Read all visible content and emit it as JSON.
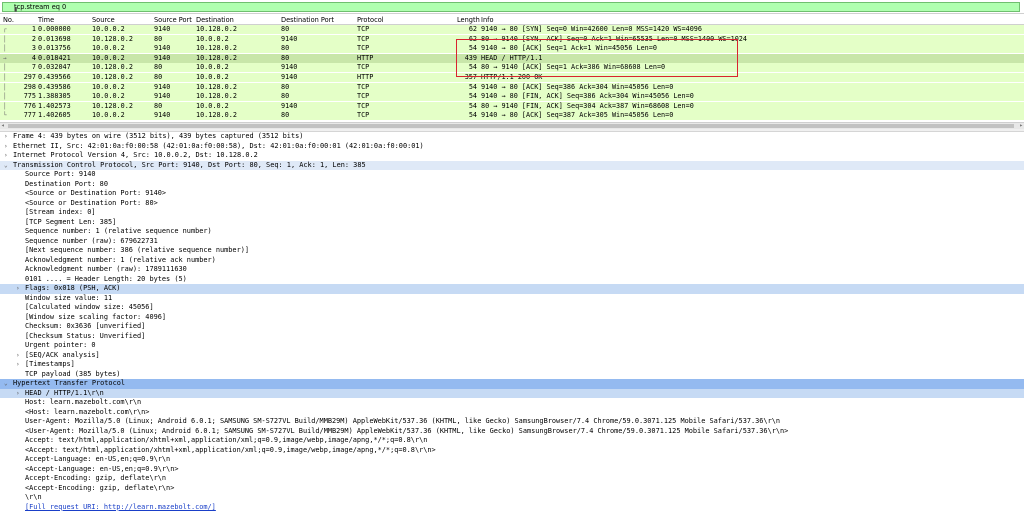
{
  "filter": {
    "value": "tcp.stream eq 0"
  },
  "columns": {
    "no": "No.",
    "time": "Time",
    "source": "Source",
    "sport": "Source Port",
    "dest": "Destination",
    "dport": "Destination Port",
    "proto": "Protocol",
    "length": "Length",
    "info": "Info"
  },
  "packets": [
    {
      "no": "1",
      "time": "0.000000",
      "src": "10.0.0.2",
      "sport": "9140",
      "dst": "10.128.0.2",
      "dport": "80",
      "proto": "TCP",
      "len": "62",
      "info": "9140 → 80 [SYN] Seq=0 Win=42600 Len=0 MSS=1420 WS=4096"
    },
    {
      "no": "2",
      "time": "0.013698",
      "src": "10.128.0.2",
      "sport": "80",
      "dst": "10.0.0.2",
      "dport": "9140",
      "proto": "TCP",
      "len": "62",
      "info": "80 → 9140 [SYN, ACK] Seq=0 Ack=1 Win=65535 Len=0 MSS=1400 WS=1024"
    },
    {
      "no": "3",
      "time": "0.013756",
      "src": "10.0.0.2",
      "sport": "9140",
      "dst": "10.128.0.2",
      "dport": "80",
      "proto": "TCP",
      "len": "54",
      "info": "9140 → 80 [ACK] Seq=1 Ack=1 Win=45056 Len=0"
    },
    {
      "no": "4",
      "time": "0.018421",
      "src": "10.0.0.2",
      "sport": "9140",
      "dst": "10.128.0.2",
      "dport": "80",
      "proto": "HTTP",
      "len": "439",
      "info": "HEAD / HTTP/1.1"
    },
    {
      "no": "7",
      "time": "0.032047",
      "src": "10.128.0.2",
      "sport": "80",
      "dst": "10.0.0.2",
      "dport": "9140",
      "proto": "TCP",
      "len": "54",
      "info": "80 → 9140 [ACK] Seq=1 Ack=386 Win=68608 Len=0"
    },
    {
      "no": "297",
      "time": "0.439566",
      "src": "10.128.0.2",
      "sport": "80",
      "dst": "10.0.0.2",
      "dport": "9140",
      "proto": "HTTP",
      "len": "357",
      "info": "HTTP/1.1 200 OK"
    },
    {
      "no": "298",
      "time": "0.439586",
      "src": "10.0.0.2",
      "sport": "9140",
      "dst": "10.128.0.2",
      "dport": "80",
      "proto": "TCP",
      "len": "54",
      "info": "9140 → 80 [ACK] Seq=386 Ack=304 Win=45056 Len=0"
    },
    {
      "no": "775",
      "time": "1.388305",
      "src": "10.0.0.2",
      "sport": "9140",
      "dst": "10.128.0.2",
      "dport": "80",
      "proto": "TCP",
      "len": "54",
      "info": "9140 → 80 [FIN, ACK] Seq=386 Ack=304 Win=45056 Len=0"
    },
    {
      "no": "776",
      "time": "1.402573",
      "src": "10.128.0.2",
      "sport": "80",
      "dst": "10.0.0.2",
      "dport": "9140",
      "proto": "TCP",
      "len": "54",
      "info": "80 → 9140 [FIN, ACK] Seq=304 Ack=387 Win=68608 Len=0"
    },
    {
      "no": "777",
      "time": "1.402605",
      "src": "10.0.0.2",
      "sport": "9140",
      "dst": "10.128.0.2",
      "dport": "80",
      "proto": "TCP",
      "len": "54",
      "info": "9140 → 80 [ACK] Seq=387 Ack=305 Win=45056 Len=0"
    }
  ],
  "selected_packet": "4",
  "details": [
    {
      "indent": 0,
      "arrow": "right",
      "text": "Frame 4: 439 bytes on wire (3512 bits), 439 bytes captured (3512 bits)"
    },
    {
      "indent": 0,
      "arrow": "right",
      "text": "Ethernet II, Src: 42:01:0a:f0:00:58 (42:01:0a:f0:00:58), Dst: 42:01:0a:f0:00:01 (42:01:0a:f0:00:01)"
    },
    {
      "indent": 0,
      "arrow": "right",
      "text": "Internet Protocol Version 4, Src: 10.0.0.2, Dst: 10.128.0.2"
    },
    {
      "indent": 0,
      "arrow": "down",
      "text": "Transmission Control Protocol, Src Port: 9140, Dst Port: 80, Seq: 1, Ack: 1, Len: 385",
      "hl": "hl1"
    },
    {
      "indent": 1,
      "text": "Source Port: 9140"
    },
    {
      "indent": 1,
      "text": "Destination Port: 80"
    },
    {
      "indent": 1,
      "text": "<Source or Destination Port: 9140>"
    },
    {
      "indent": 1,
      "text": "<Source or Destination Port: 80>"
    },
    {
      "indent": 1,
      "text": "[Stream index: 0]"
    },
    {
      "indent": 1,
      "text": "[TCP Segment Len: 385]"
    },
    {
      "indent": 1,
      "text": "Sequence number: 1    (relative sequence number)"
    },
    {
      "indent": 1,
      "text": "Sequence number (raw): 679622731"
    },
    {
      "indent": 1,
      "text": "[Next sequence number: 386    (relative sequence number)]"
    },
    {
      "indent": 1,
      "text": "Acknowledgment number: 1    (relative ack number)"
    },
    {
      "indent": 1,
      "text": "Acknowledgment number (raw): 1789111630"
    },
    {
      "indent": 1,
      "text": "0101 .... = Header Length: 20 bytes (5)"
    },
    {
      "indent": 1,
      "arrow": "right",
      "text": "Flags: 0x018 (PSH, ACK)",
      "hl": "hl2"
    },
    {
      "indent": 1,
      "text": "Window size value: 11"
    },
    {
      "indent": 1,
      "text": "[Calculated window size: 45056]"
    },
    {
      "indent": 1,
      "text": "[Window size scaling factor: 4096]"
    },
    {
      "indent": 1,
      "text": "Checksum: 0x3636 [unverified]"
    },
    {
      "indent": 1,
      "text": "[Checksum Status: Unverified]"
    },
    {
      "indent": 1,
      "text": "Urgent pointer: 0"
    },
    {
      "indent": 1,
      "arrow": "right",
      "text": "[SEQ/ACK analysis]"
    },
    {
      "indent": 1,
      "arrow": "right",
      "text": "[Timestamps]"
    },
    {
      "indent": 1,
      "text": "TCP payload (385 bytes)"
    },
    {
      "indent": 0,
      "arrow": "down",
      "text": "Hypertext Transfer Protocol",
      "hl": "hl3"
    },
    {
      "indent": 1,
      "arrow": "right",
      "text": "HEAD / HTTP/1.1\\r\\n",
      "hl": "hl2"
    },
    {
      "indent": 1,
      "text": "Host: learn.mazebolt.com\\r\\n"
    },
    {
      "indent": 1,
      "text": "<Host: learn.mazebolt.com\\r\\n>"
    },
    {
      "indent": 1,
      "text": "User-Agent: Mozilla/5.0 (Linux; Android 6.0.1; SAMSUNG SM-S727VL Build/MMB29M) AppleWebKit/537.36 (KHTML, like Gecko) SamsungBrowser/7.4 Chrome/59.0.3071.125 Mobile Safari/537.36\\r\\n"
    },
    {
      "indent": 1,
      "text": "<User-Agent: Mozilla/5.0 (Linux; Android 6.0.1; SAMSUNG SM-S727VL Build/MMB29M) AppleWebKit/537.36 (KHTML, like Gecko) SamsungBrowser/7.4 Chrome/59.0.3071.125 Mobile Safari/537.36\\r\\n>"
    },
    {
      "indent": 1,
      "text": "Accept: text/html,application/xhtml+xml,application/xml;q=0.9,image/webp,image/apng,*/*;q=0.8\\r\\n"
    },
    {
      "indent": 1,
      "text": "<Accept: text/html,application/xhtml+xml,application/xml;q=0.9,image/webp,image/apng,*/*;q=0.8\\r\\n>"
    },
    {
      "indent": 1,
      "text": "Accept-Language: en-US,en;q=0.9\\r\\n"
    },
    {
      "indent": 1,
      "text": "<Accept-Language: en-US,en;q=0.9\\r\\n>"
    },
    {
      "indent": 1,
      "text": "Accept-Encoding: gzip, deflate\\r\\n"
    },
    {
      "indent": 1,
      "text": "<Accept-Encoding: gzip, deflate\\r\\n>"
    },
    {
      "indent": 1,
      "text": "\\r\\n"
    },
    {
      "indent": 1,
      "text": "[Full request URI: http://learn.mazebolt.com/]",
      "link": true
    }
  ]
}
